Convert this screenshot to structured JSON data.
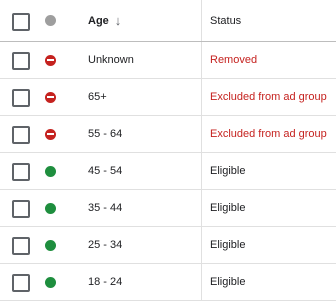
{
  "header": {
    "age_label": "Age",
    "sort_glyph": "↓",
    "status_label": "Status",
    "status_icon": "status-dot-icon"
  },
  "colors": {
    "eligible": "#1e8e3e",
    "removed": "#c5221f",
    "header_dot": "#9e9e9e"
  },
  "rows": [
    {
      "age": "Unknown",
      "status": "Removed",
      "state": "removed"
    },
    {
      "age": "65+",
      "status": "Excluded from ad group",
      "state": "removed"
    },
    {
      "age": "55 - 64",
      "status": "Excluded from ad group",
      "state": "removed"
    },
    {
      "age": "45 - 54",
      "status": "Eligible",
      "state": "eligible"
    },
    {
      "age": "35 - 44",
      "status": "Eligible",
      "state": "eligible"
    },
    {
      "age": "25 - 34",
      "status": "Eligible",
      "state": "eligible"
    },
    {
      "age": "18 - 24",
      "status": "Eligible",
      "state": "eligible"
    }
  ]
}
